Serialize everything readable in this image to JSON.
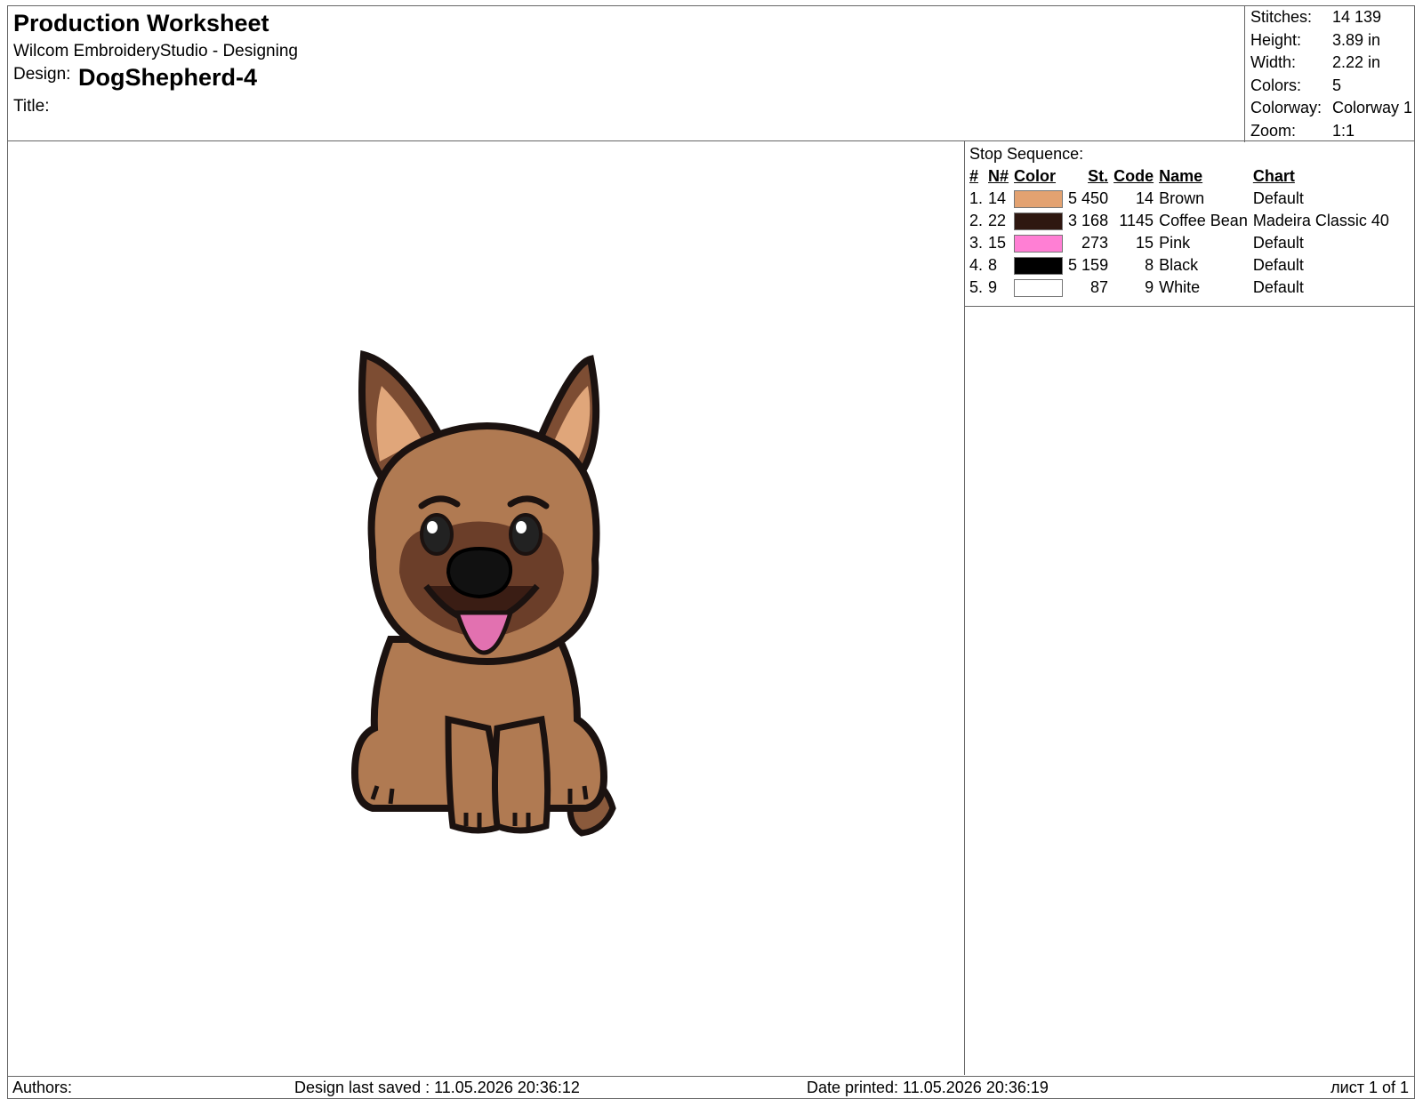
{
  "header": {
    "title": "Production Worksheet",
    "app": "Wilcom EmbroideryStudio - Designing",
    "design_label": "Design:",
    "design_name": "DogShepherd-4",
    "title_label": "Title:"
  },
  "summary": [
    {
      "label": "Stitches:",
      "value": "14 139"
    },
    {
      "label": "Height:",
      "value": "3.89 in"
    },
    {
      "label": "Width:",
      "value": "2.22 in"
    },
    {
      "label": "Colors:",
      "value": "5"
    },
    {
      "label": "Colorway:",
      "value": "Colorway 1"
    },
    {
      "label": "Zoom:",
      "value": "1:1"
    }
  ],
  "stop_sequence": {
    "title": "Stop Sequence:",
    "columns": [
      "#",
      "N#",
      "Color",
      "St.",
      "Code",
      "Name",
      "Chart"
    ],
    "rows": [
      {
        "idx": "1.",
        "n": "14",
        "color": "#E3A271",
        "st": "5 450",
        "code": "14",
        "name": "Brown",
        "chart": "Default"
      },
      {
        "idx": "2.",
        "n": "22",
        "color": "#2E1710",
        "st": "3 168",
        "code": "1145",
        "name": "Coffee Bean",
        "chart": "Madeira Classic 40"
      },
      {
        "idx": "3.",
        "n": "15",
        "color": "#FF7FD4",
        "st": "273",
        "code": "15",
        "name": "Pink",
        "chart": "Default"
      },
      {
        "idx": "4.",
        "n": "8",
        "color": "#000000",
        "st": "5 159",
        "code": "8",
        "name": "Black",
        "chart": "Default"
      },
      {
        "idx": "5.",
        "n": "9",
        "color": "#FFFFFF",
        "st": "87",
        "code": "9",
        "name": "White",
        "chart": "Default"
      }
    ]
  },
  "footer": {
    "authors": "Authors:",
    "saved": "Design last saved : 11.05.2026 20:36:12",
    "printed": "Date printed: 11.05.2026 20:36:19",
    "page": "лист 1 of 1"
  }
}
